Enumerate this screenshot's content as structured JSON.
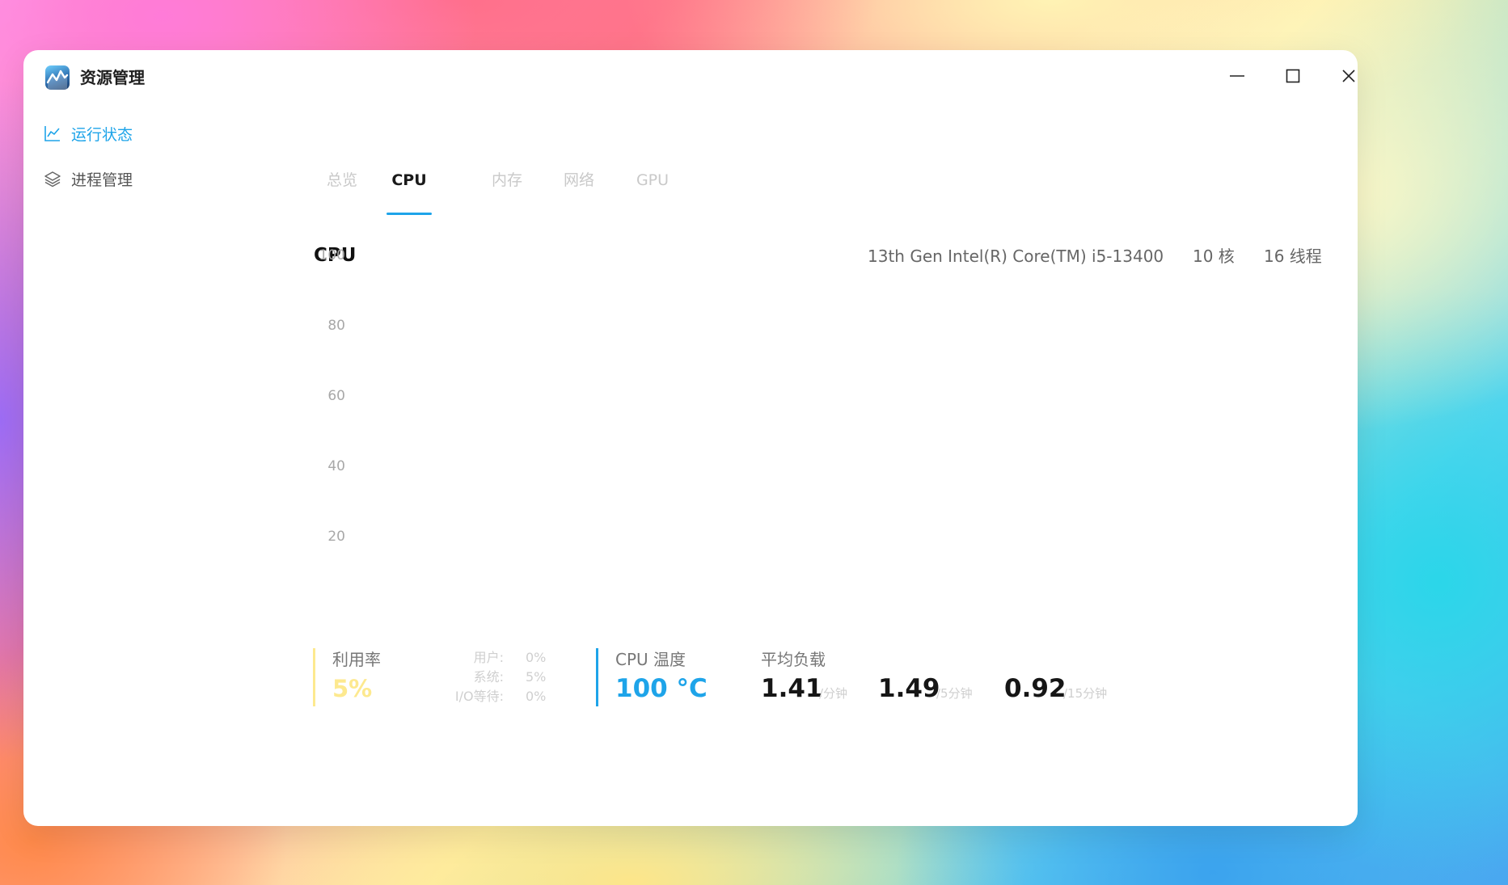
{
  "app": {
    "title": "资源管理",
    "icon": "activity-monitor-app-icon"
  },
  "window_controls": {
    "minimize_icon": "minimize-icon",
    "maximize_icon": "maximize-icon",
    "close_icon": "close-icon"
  },
  "sidebar": {
    "items": [
      {
        "label": "运行状态",
        "icon": "line-chart-icon",
        "active": true
      },
      {
        "label": "进程管理",
        "icon": "layers-icon",
        "active": false
      }
    ]
  },
  "tabs": [
    {
      "label": "总览",
      "active": false
    },
    {
      "label": "CPU",
      "active": true
    },
    {
      "label": "内存",
      "active": false
    },
    {
      "label": "网络",
      "active": false
    },
    {
      "label": "GPU",
      "active": false
    }
  ],
  "cpu": {
    "title": "CPU",
    "model": "13th Gen Intel(R) Core(TM) i5-13400",
    "cores": "10 核",
    "threads": "16 线程"
  },
  "chart_data": {
    "type": "line",
    "title": "",
    "xlabel": "",
    "ylabel": "",
    "ylim": [
      0,
      100
    ],
    "yticks": [
      "100",
      "80",
      "60",
      "40",
      "20"
    ],
    "series": []
  },
  "stats": {
    "usage": {
      "label": "利用率",
      "value": "5%",
      "breakdown": [
        {
          "label": "用户:",
          "value": "0%"
        },
        {
          "label": "系统:",
          "value": "5%"
        },
        {
          "label": "I/O等待:",
          "value": "0%"
        }
      ]
    },
    "temperature": {
      "label": "CPU 温度",
      "value": "100 °C"
    },
    "load": {
      "label": "平均负载",
      "values": [
        {
          "value": "1.41",
          "unit": "/分钟"
        },
        {
          "value": "1.49",
          "unit": "/5分钟"
        },
        {
          "value": "0.92",
          "unit": "/15分钟"
        }
      ]
    }
  },
  "colors": {
    "accent": "#1ea4e9",
    "usage_yellow": "#fde98f",
    "window_bg": "#ffffff"
  }
}
